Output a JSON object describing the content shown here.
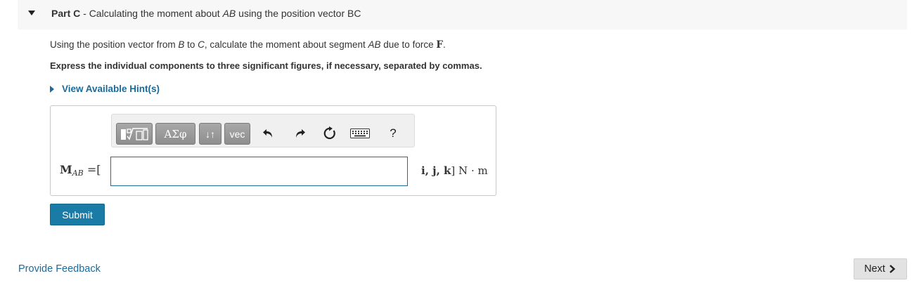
{
  "part": {
    "label": "Part C",
    "separator": " - ",
    "title_pre": "Calculating the moment about ",
    "title_ab": "AB",
    "title_post": " using the position vector BC"
  },
  "prompt": {
    "pre": "Using the position vector from ",
    "b": "B",
    "to": " to ",
    "c": "C",
    "mid": ", calculate the moment about segment ",
    "ab": "AB",
    "post": " due to force ",
    "force": "F",
    "end": "."
  },
  "instruction": "Express the individual components to three significant figures, if necessary, separated by commas.",
  "hint_label": "View Available Hint(s)",
  "toolbar": {
    "greek": "ΑΣφ",
    "sort": "↓↑",
    "vec": "vec",
    "help": "?"
  },
  "answer": {
    "symbol": "M",
    "subscript": "AB",
    "equals": " =[",
    "value": "",
    "units_vectors": "i, j, k",
    "units_close": "]",
    "units": " N · m"
  },
  "submit_label": "Submit",
  "feedback_label": "Provide Feedback",
  "next_label": "Next"
}
